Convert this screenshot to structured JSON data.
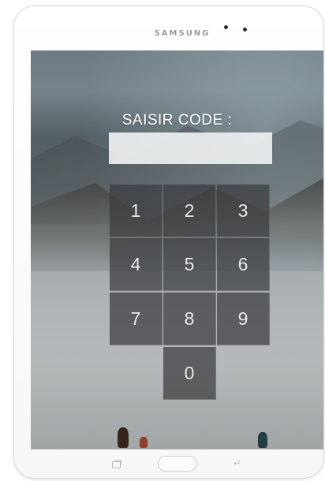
{
  "device": {
    "brand": "SAMSUNG"
  },
  "lock_screen": {
    "prompt": "SAISIR CODE :",
    "code_value": "",
    "keys": [
      "1",
      "2",
      "3",
      "4",
      "5",
      "6",
      "7",
      "8",
      "9",
      "0"
    ]
  },
  "nav_bar": {
    "recent_icon": "recent-apps-icon",
    "home_icon": "home-button",
    "back_icon": "back-icon"
  }
}
